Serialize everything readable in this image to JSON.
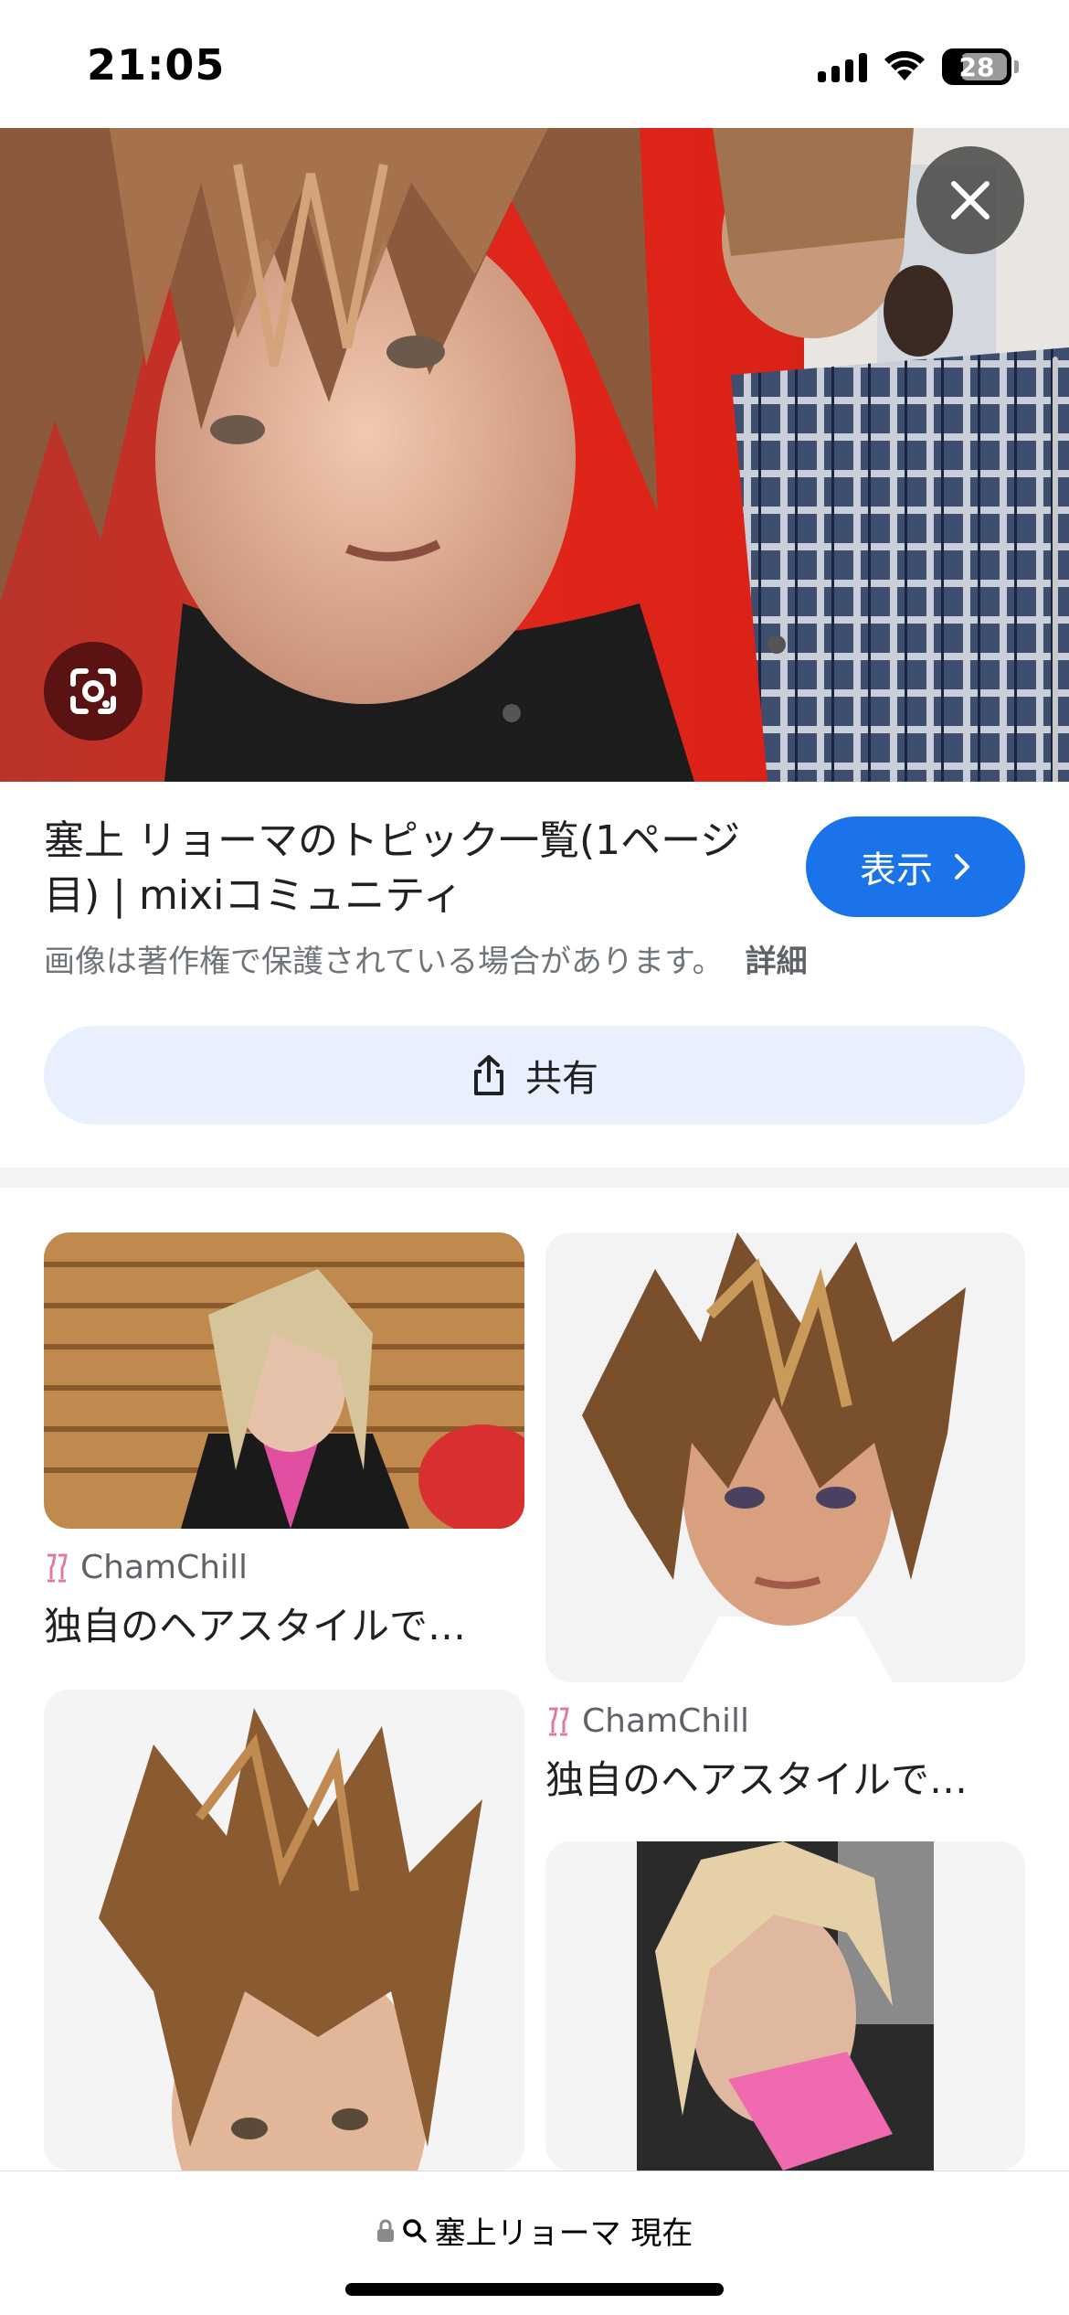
{
  "status_bar": {
    "time": "21:05",
    "battery_level": "28",
    "battery_fraction": 0.28
  },
  "hero": {
    "close_icon": "close-icon",
    "lens_icon": "google-lens-icon"
  },
  "result": {
    "title": "塞上 リョーマのトピック一覧(1ページ目) | mixiコミュニティ",
    "view_label": "表示",
    "copyright_notice": "画像は著作権で保護されている場合があります。",
    "details_label": "詳細",
    "share_label": "共有"
  },
  "grid": {
    "items": [
      {
        "source": "ChamChill",
        "caption": "独自のヘアスタイルで…"
      },
      {
        "source": "ChamChill",
        "caption": "独自のヘアスタイルで…"
      },
      {
        "source": "",
        "caption": ""
      },
      {
        "source": "",
        "caption": ""
      }
    ]
  },
  "bottom_bar": {
    "url_text": "塞上リョーマ 現在"
  },
  "colors": {
    "accent": "#1a73e8",
    "share_bg": "#e8f0fe",
    "muted_text": "#70757a"
  }
}
